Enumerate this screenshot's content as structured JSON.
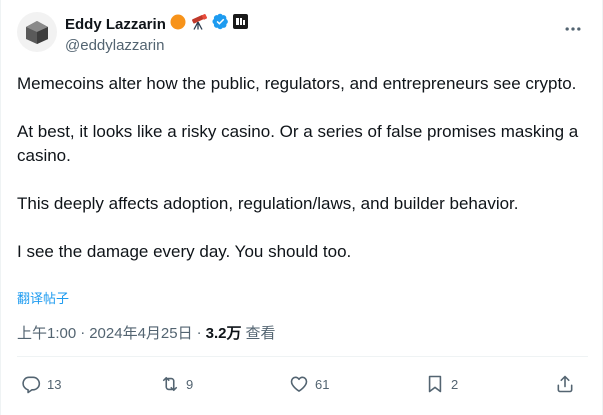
{
  "author": {
    "display_name": "Eddy Lazzarin",
    "handle": "@eddylazzarin",
    "badges": [
      "orange-circle-icon",
      "telescope-icon",
      "verified-badge-icon",
      "affiliate-badge-icon"
    ]
  },
  "tweet": {
    "paragraphs": [
      "Memecoins alter how the public, regulators, and entrepreneurs see crypto.",
      "At best, it looks like a risky casino. Or a series of false promises masking a casino.",
      "This deeply affects adoption, regulation/laws, and builder behavior.",
      "I see the damage every day. You should too."
    ],
    "translate_label": "翻译帖子"
  },
  "meta": {
    "time": "上午1:00",
    "separator": "·",
    "date": "2024年4月25日",
    "views_count": "3.2万",
    "views_label": "查看"
  },
  "actions": {
    "replies": "13",
    "reposts": "9",
    "likes": "61",
    "bookmarks": "2"
  },
  "colors": {
    "text": "#0f1419",
    "secondary": "#536471",
    "accent": "#1d9bf0",
    "border": "#eff3f4"
  }
}
